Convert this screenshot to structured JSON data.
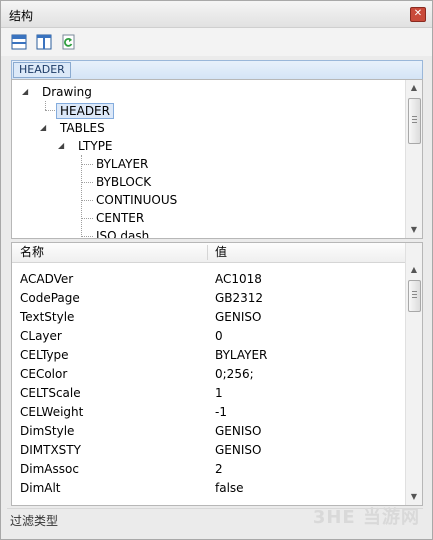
{
  "window": {
    "title": "结构"
  },
  "toolbar": {
    "buttons": [
      {
        "name": "layout-horizontal-icon"
      },
      {
        "name": "layout-vertical-icon"
      },
      {
        "name": "refresh-icon"
      }
    ]
  },
  "breadcrumb": {
    "current": "HEADER"
  },
  "tree": {
    "drawing": "Drawing",
    "header": "HEADER",
    "tables": "TABLES",
    "ltype": "LTYPE",
    "items": [
      "BYLAYER",
      "BYBLOCK",
      "CONTINUOUS",
      "CENTER",
      "ISO dash"
    ]
  },
  "properties": {
    "columns": {
      "name": "名称",
      "value": "值"
    },
    "rows": [
      {
        "name": "ACADVer",
        "value": "AC1018"
      },
      {
        "name": "CodePage",
        "value": "GB2312"
      },
      {
        "name": "TextStyle",
        "value": "GENISO"
      },
      {
        "name": "CLayer",
        "value": "0"
      },
      {
        "name": "CELType",
        "value": "BYLAYER"
      },
      {
        "name": "CEColor",
        "value": "0;256;"
      },
      {
        "name": "CELTScale",
        "value": "1"
      },
      {
        "name": "CELWeight",
        "value": "-1"
      },
      {
        "name": "DimStyle",
        "value": "GENISO"
      },
      {
        "name": "DIMTXSTY",
        "value": "GENISO"
      },
      {
        "name": "DimAssoc",
        "value": "2"
      },
      {
        "name": "DimAlt",
        "value": "false"
      }
    ]
  },
  "status": {
    "text": "过滤类型"
  },
  "watermark": {
    "text": "3HE 当游网"
  }
}
